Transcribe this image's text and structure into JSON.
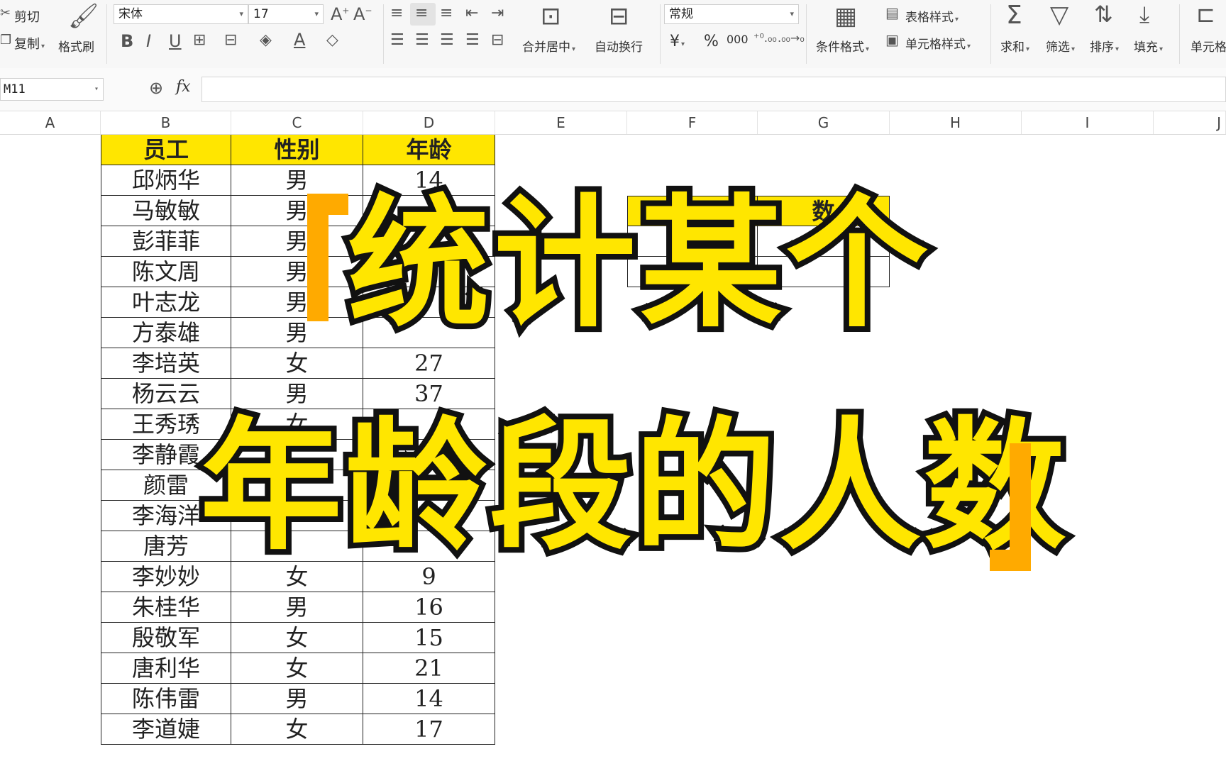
{
  "ribbon": {
    "clipboard": {
      "cut_label": "剪切",
      "copy_label": "复制",
      "format_painter_label": "格式刷"
    },
    "font": {
      "name": "宋体",
      "size": "17"
    },
    "alignment": {
      "merge_center_label": "合并居中",
      "wrap_text_label": "自动换行"
    },
    "number": {
      "format": "常规",
      "currency_symbol": "¥",
      "percent_symbol": "%",
      "thousands": "000"
    },
    "styles": {
      "conditional_format_label": "条件格式",
      "table_style_label": "表格样式",
      "cell_style_label": "单元格样式"
    },
    "editing": {
      "sum_label": "求和",
      "filter_label": "筛选",
      "sort_label": "排序",
      "fill_label": "填充",
      "cell_label": "单元格"
    }
  },
  "formula_bar": {
    "cell_ref": "M11",
    "fx_label": "fx",
    "content": ""
  },
  "columns": [
    "A",
    "B",
    "C",
    "D",
    "E",
    "F",
    "G",
    "H",
    "I",
    "J"
  ],
  "table": {
    "headers": [
      "员工",
      "性别",
      "年龄"
    ],
    "rows": [
      [
        "邱炳华",
        "男",
        "14"
      ],
      [
        "马敏敏",
        "男",
        ""
      ],
      [
        "彭菲菲",
        "男",
        ""
      ],
      [
        "陈文周",
        "男",
        ""
      ],
      [
        "叶志龙",
        "男",
        ""
      ],
      [
        "方泰雄",
        "男",
        ""
      ],
      [
        "李培英",
        "女",
        "27"
      ],
      [
        "杨云云",
        "男",
        "37"
      ],
      [
        "王秀琇",
        "女",
        ""
      ],
      [
        "李静霞",
        "",
        ""
      ],
      [
        "颜雷",
        "",
        ""
      ],
      [
        "李海洋",
        "",
        ""
      ],
      [
        "唐芳",
        "",
        ""
      ],
      [
        "李妙妙",
        "女",
        "9"
      ],
      [
        "朱桂华",
        "男",
        "16"
      ],
      [
        "殷敬军",
        "女",
        "15"
      ],
      [
        "唐利华",
        "女",
        "21"
      ],
      [
        "陈伟雷",
        "男",
        "14"
      ],
      [
        "李道婕",
        "女",
        "17"
      ]
    ]
  },
  "summary_table": {
    "header_right": "数"
  },
  "overlay": {
    "line1": "统计某个",
    "line2": "年龄段的人数",
    "accent_color": "#ffe600",
    "stroke_color": "#111111",
    "bracket_color": "#ffaa00"
  },
  "colors": {
    "header_fill": "#ffe600"
  }
}
